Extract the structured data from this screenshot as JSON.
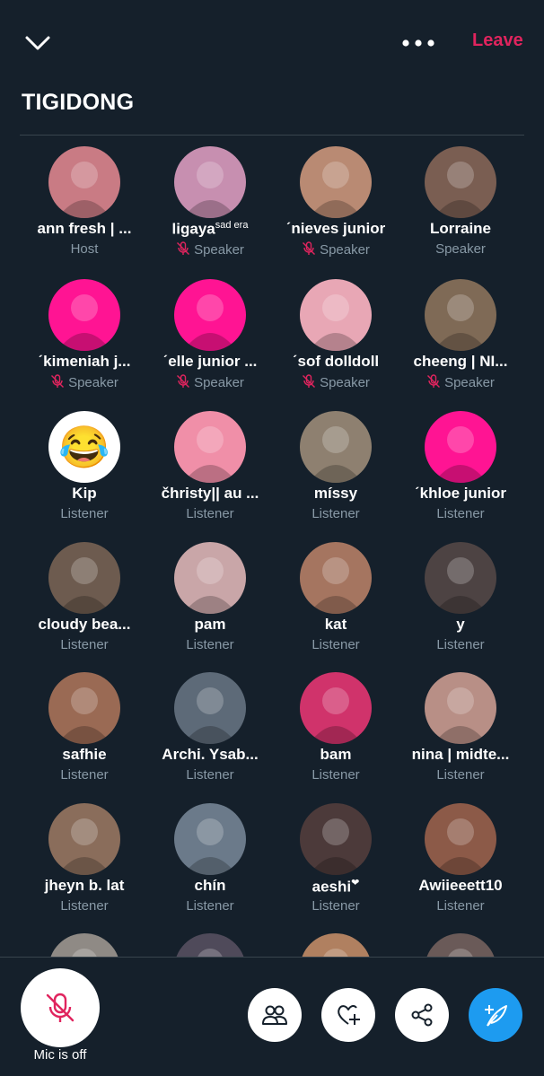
{
  "header": {
    "leave_label": "Leave",
    "title": "TIGIDONG"
  },
  "participants": [
    {
      "name": "ann fresh | ...",
      "role": "Host",
      "muted": false,
      "avatar_color": "#c97b84"
    },
    {
      "name": "ligaya",
      "name_suffix": "sad era",
      "role": "Speaker",
      "muted": true,
      "avatar_color": "#c78fb0"
    },
    {
      "name": "ˊnieves junior",
      "role": "Speaker",
      "muted": true,
      "avatar_color": "#b98a73"
    },
    {
      "name": "Lorraine",
      "role": "Speaker",
      "muted": false,
      "avatar_color": "#7a5e52"
    },
    {
      "name": "ˊkimeniah j...",
      "role": "Speaker",
      "muted": true,
      "avatar_color": "#ff1493"
    },
    {
      "name": "ˊelle junior ...",
      "role": "Speaker",
      "muted": true,
      "avatar_color": "#ff1493"
    },
    {
      "name": "ˊsof dolldoll",
      "role": "Speaker",
      "muted": true,
      "avatar_color": "#e8a7b5"
    },
    {
      "name": "cheeng | NI...",
      "role": "Speaker",
      "muted": true,
      "avatar_color": "#7f6a56"
    },
    {
      "name": "Kip",
      "role": "Listener",
      "muted": false,
      "avatar_color": "#ffffff",
      "emoji": "😂"
    },
    {
      "name": "čhristy|| au ...",
      "role": "Listener",
      "muted": false,
      "avatar_color": "#f08fa8"
    },
    {
      "name": "míssy",
      "role": "Listener",
      "muted": false,
      "avatar_color": "#8e8070"
    },
    {
      "name": "ˊkhloe junior",
      "role": "Listener",
      "muted": false,
      "avatar_color": "#ff1493"
    },
    {
      "name": "cloudy bea...",
      "role": "Listener",
      "muted": false,
      "avatar_color": "#6d5b4f"
    },
    {
      "name": "pam",
      "role": "Listener",
      "muted": false,
      "avatar_color": "#c9a6a8"
    },
    {
      "name": "kat",
      "role": "Listener",
      "muted": false,
      "avatar_color": "#a57560"
    },
    {
      "name": "y",
      "role": "Listener",
      "muted": false,
      "avatar_color": "#4d4343"
    },
    {
      "name": "safhie",
      "role": "Listener",
      "muted": false,
      "avatar_color": "#9a6a54"
    },
    {
      "name": "Archi. Ysab...",
      "role": "Listener",
      "muted": false,
      "avatar_color": "#5d6a78"
    },
    {
      "name": "bam",
      "role": "Listener",
      "muted": false,
      "avatar_color": "#d0336b"
    },
    {
      "name": "nina | midte...",
      "role": "Listener",
      "muted": false,
      "avatar_color": "#b88f86"
    },
    {
      "name": "jheyn b. lat",
      "role": "Listener",
      "muted": false,
      "avatar_color": "#8a6d5b"
    },
    {
      "name": "chín",
      "role": "Listener",
      "muted": false,
      "avatar_color": "#6b7a8a"
    },
    {
      "name": "aeshi",
      "name_suffix": "❤",
      "role": "Listener",
      "muted": false,
      "avatar_color": "#4c3a3a"
    },
    {
      "name": "Awiieeett10",
      "role": "Listener",
      "muted": false,
      "avatar_color": "#8c5a48"
    }
  ],
  "partial_row_avatar_colors": [
    "#8f8a85",
    "#4f4a5a",
    "#b08060",
    "#6a5a58"
  ],
  "bottom": {
    "mic_label": "Mic is off"
  },
  "colors": {
    "background": "#15202b",
    "accent_red": "#e0245e",
    "accent_blue": "#1d9bf0",
    "secondary_text": "#8899a6"
  }
}
